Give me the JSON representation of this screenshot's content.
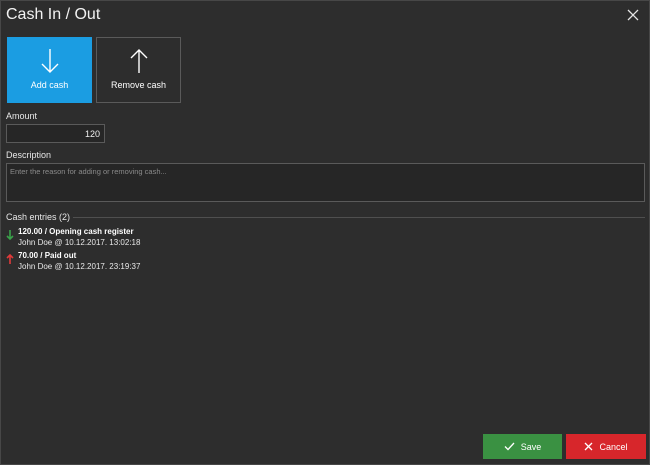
{
  "window": {
    "title": "Cash In / Out"
  },
  "actions": {
    "add_label": "Add cash",
    "remove_label": "Remove cash"
  },
  "amount": {
    "label": "Amount",
    "value": "120"
  },
  "description": {
    "label": "Description",
    "placeholder": "Enter the reason for adding or removing cash...",
    "value": ""
  },
  "entries": {
    "header": "Cash entries (2)",
    "items": [
      {
        "direction": "in",
        "summary": "120.00 / Opening cash register",
        "detail": "John Doe @ 10.12.2017. 13:02:18",
        "color": "#3aa24a"
      },
      {
        "direction": "out",
        "summary": "70.00 / Paid out",
        "detail": "John Doe @ 10.12.2017. 23:19:37",
        "color": "#e03a3a"
      }
    ]
  },
  "footer": {
    "save_label": "Save",
    "cancel_label": "Cancel"
  },
  "colors": {
    "accent": "#1b9de2",
    "save": "#3a9142",
    "cancel": "#d7262b",
    "background": "#2d2d2d"
  },
  "icons": {
    "close": "close-icon",
    "add": "arrow-down-icon",
    "remove": "arrow-up-icon",
    "save": "check-icon",
    "cancel": "x-icon"
  }
}
